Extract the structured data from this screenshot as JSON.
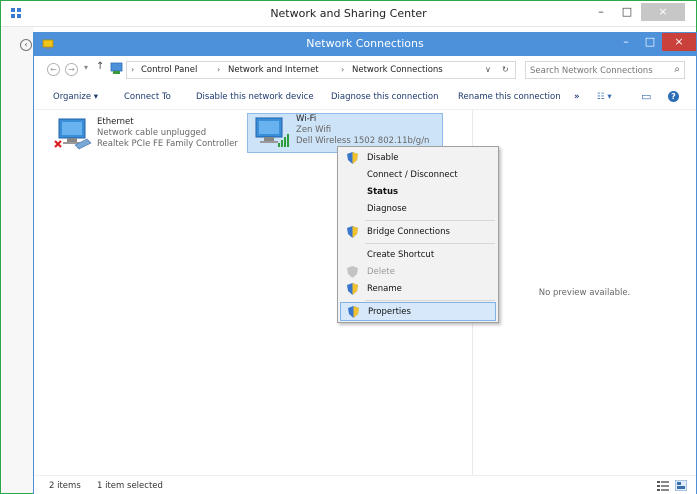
{
  "back_window": {
    "title": "Network and Sharing Center",
    "minimize": "–",
    "maximize": "□",
    "close": "×",
    "back": "‹"
  },
  "window": {
    "title": "Network Connections",
    "minimize": "–",
    "maximize": "□",
    "close": "×"
  },
  "nav": {
    "back": "←",
    "forward": "→",
    "recent": "▾",
    "up": "↑"
  },
  "address": {
    "crumbs": [
      "Control Panel",
      "Network and Internet",
      "Network Connections"
    ],
    "separator": "›",
    "dropdown": "∨",
    "refresh": "↻"
  },
  "search": {
    "placeholder": "Search Network Connections",
    "icon": "⌕"
  },
  "toolbar": {
    "organize": "Organize ▾",
    "connect_to": "Connect To",
    "disable": "Disable this network device",
    "diagnose": "Diagnose this connection",
    "rename": "Rename this connection",
    "more": "»",
    "view": "☷ ▾",
    "pane": "▭",
    "help": "?"
  },
  "connections": [
    {
      "name": "Ethernet",
      "status": "Network cable unplugged",
      "device": "Realtek PCIe FE Family Controller"
    },
    {
      "name": "Wi-Fi",
      "status": "Zen Wifi",
      "device": "Dell Wireless 1502 802.11b/g/n"
    }
  ],
  "context_menu": {
    "items": [
      {
        "label": "Disable",
        "shield": true
      },
      {
        "label": "Connect / Disconnect"
      },
      {
        "label": "Status",
        "bold": true
      },
      {
        "label": "Diagnose"
      },
      {
        "label": "Bridge Connections",
        "shield": true
      },
      {
        "label": "Create Shortcut"
      },
      {
        "label": "Delete",
        "shield": true,
        "disabled": true
      },
      {
        "label": "Rename",
        "shield": true
      },
      {
        "label": "Properties",
        "shield": true,
        "highlighted": true
      }
    ]
  },
  "preview": {
    "text": "No preview available."
  },
  "status": {
    "count": "2 items",
    "selected": "1 item selected"
  },
  "colors": {
    "titlebar": "#4d91db",
    "close": "#c9413a",
    "selection": "#cde3f7",
    "back_border": "#2ba84a"
  }
}
